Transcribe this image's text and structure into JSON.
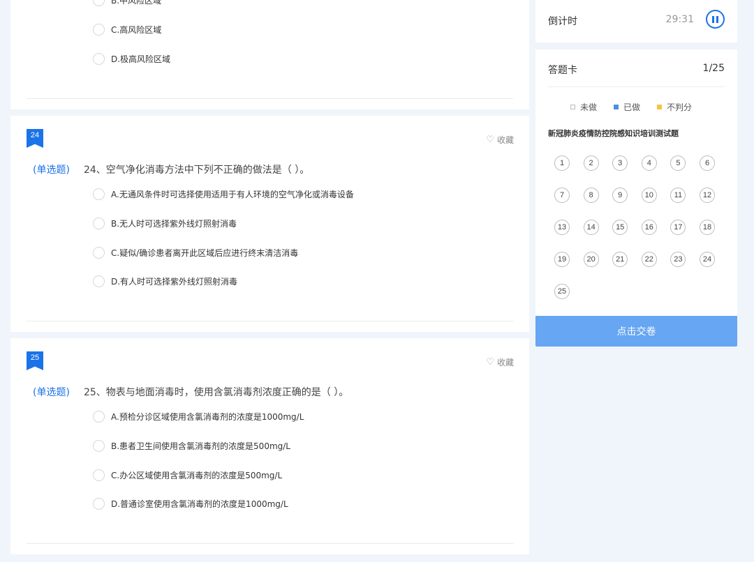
{
  "top_options": [
    {
      "label": "B.中风险区域"
    },
    {
      "label": "C.高风险区域"
    },
    {
      "label": "D.极高风险区域"
    }
  ],
  "questions": [
    {
      "badge": "24",
      "fav_label": "收藏",
      "type": "(单选题)",
      "text": "24、空气净化消毒方法中下列不正确的做法是（ ）。",
      "options": [
        "A.无通风条件时可选择使用适用于有人环境的空气净化或消毒设备",
        "B.无人时可选择紫外线灯照射消毒",
        "C.疑似/确诊患者离开此区域后应进行终末清洁消毒",
        "D.有人时可选择紫外线灯照射消毒"
      ]
    },
    {
      "badge": "25",
      "fav_label": "收藏",
      "type": "(单选题)",
      "text": "25、物表与地面消毒时，使用含氯消毒剂浓度正确的是（ ）。",
      "options": [
        "A.预检分诊区域使用含氯消毒剂的浓度是1000mg/L",
        "B.患者卫生间使用含氯消毒剂的浓度是500mg/L",
        "C.办公区域使用含氯消毒剂的浓度是500mg/L",
        "D.普通诊室使用含氯消毒剂的浓度是1000mg/L"
      ]
    }
  ],
  "timer": {
    "label": "倒计时",
    "value": "29:31",
    "icon": "pause-icon"
  },
  "answer_card": {
    "title": "答题卡",
    "count": "1/25",
    "legend": [
      {
        "label": "未做",
        "color": "#ffffff"
      },
      {
        "label": "已做",
        "color": "#4a90e2"
      },
      {
        "label": "不判分",
        "color": "#f5c342"
      }
    ],
    "exam_title": "新冠肺炎疫情防控院感知识培训测试题",
    "numbers": [
      "1",
      "2",
      "3",
      "4",
      "5",
      "6",
      "7",
      "8",
      "9",
      "10",
      "11",
      "12",
      "13",
      "14",
      "15",
      "16",
      "17",
      "18",
      "19",
      "20",
      "21",
      "22",
      "23",
      "24",
      "25"
    ]
  },
  "submit_label": "点击交卷",
  "colors": {
    "accent": "#1a73e8",
    "submit": "#66a6f2",
    "background": "#f0f5fb"
  }
}
